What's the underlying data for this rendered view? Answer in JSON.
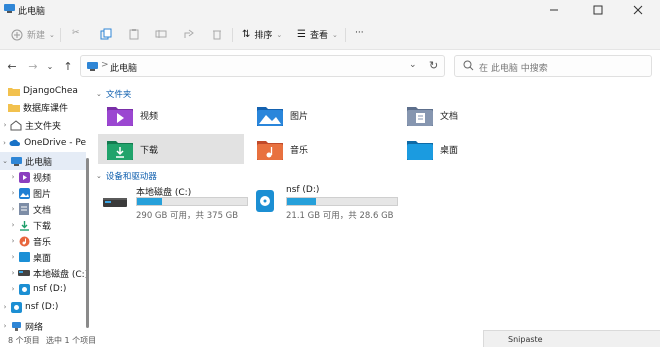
{
  "window": {
    "title": "此电脑"
  },
  "toolbar": {
    "new_label": "新建",
    "sort_label": "排序",
    "view_label": "查看",
    "more_label": "···"
  },
  "address": {
    "crumb": "此电脑",
    "separator": ">"
  },
  "search": {
    "placeholder": "在 此电脑 中搜索"
  },
  "sidebar": {
    "items": [
      {
        "label": "DjangoChea"
      },
      {
        "label": "数据库课件"
      },
      {
        "label": "主文件夹"
      },
      {
        "label": "OneDrive - Pe"
      },
      {
        "label": "此电脑"
      },
      {
        "label": "视频"
      },
      {
        "label": "图片"
      },
      {
        "label": "文档"
      },
      {
        "label": "下载"
      },
      {
        "label": "音乐"
      },
      {
        "label": "桌面"
      },
      {
        "label": "本地磁盘 (C:)"
      },
      {
        "label": "nsf (D:)"
      },
      {
        "label": "nsf (D:)"
      },
      {
        "label": "网络"
      }
    ]
  },
  "content": {
    "folders_header": "文件夹",
    "folders": [
      {
        "label": "视频"
      },
      {
        "label": "图片"
      },
      {
        "label": "文档"
      },
      {
        "label": "下载"
      },
      {
        "label": "音乐"
      },
      {
        "label": "桌面"
      }
    ],
    "drives_header": "设备和驱动器",
    "drives": [
      {
        "name": "本地磁盘 (C:)",
        "info": "290 GB 可用，共 375 GB",
        "used_fraction": 0.227
      },
      {
        "name": "nsf (D:)",
        "info": "21.1 GB 可用，共 28.6 GB",
        "used_fraction": 0.262
      }
    ]
  },
  "statusbar": {
    "count": "8 个项目",
    "selected": "选中 1 个项目"
  },
  "snipaste": {
    "label": "Snipaste"
  },
  "colors": {
    "accent": "#26a0da",
    "link": "#0b5cad",
    "selection": "#e2e2e2"
  }
}
